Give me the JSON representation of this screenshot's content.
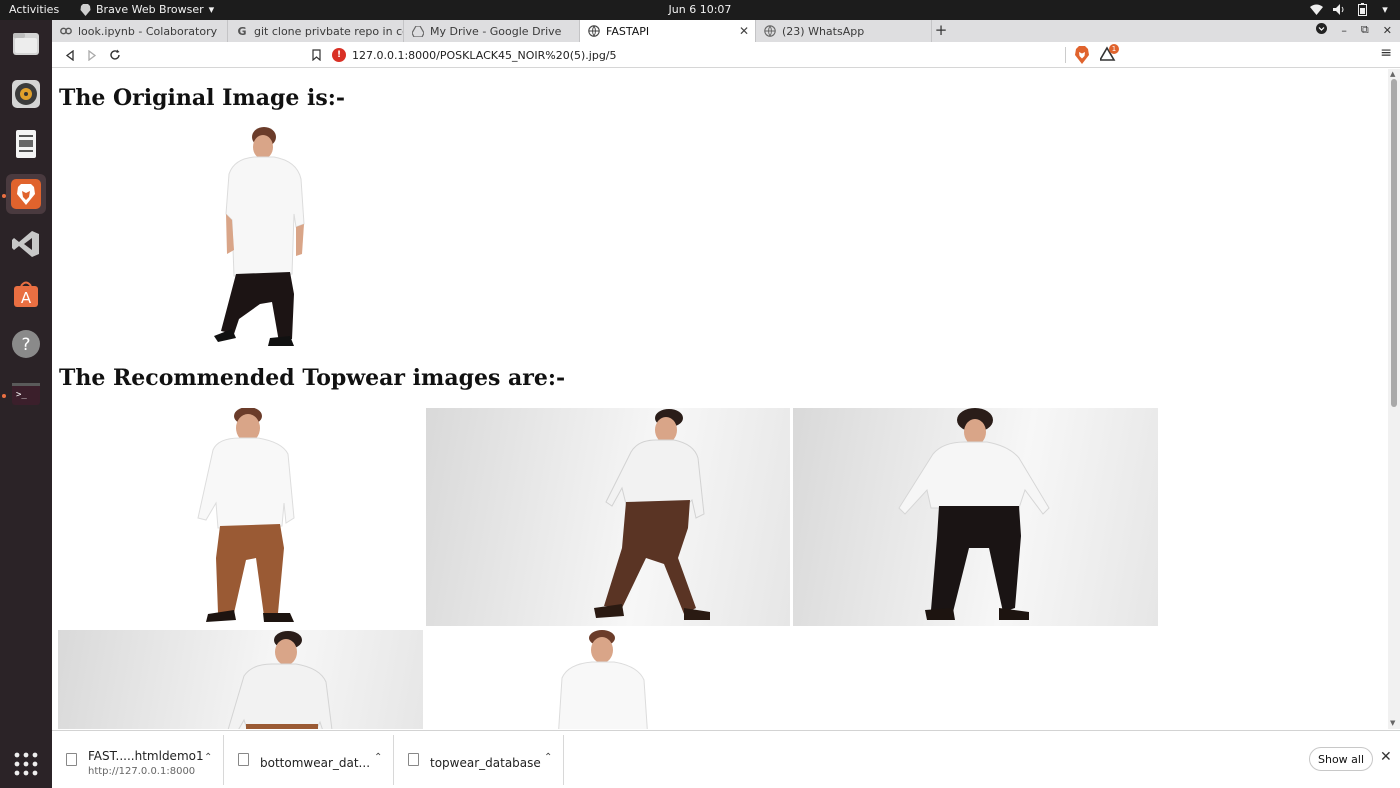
{
  "topbar": {
    "activities": "Activities",
    "app_menu": "Brave Web Browser",
    "clock": "Jun 6  10:07",
    "tray_icons": [
      "wifi-icon",
      "volume-icon",
      "battery-icon",
      "power-menu-icon"
    ]
  },
  "dock": {
    "items": [
      "files-icon",
      "rhythmbox-icon",
      "document-viewer-icon",
      "brave-browser-icon",
      "vscode-icon",
      "software-store-icon",
      "help-icon",
      "terminal-icon"
    ],
    "show_apps_icon": "app-grid-icon"
  },
  "tabs": [
    {
      "title": "look.ipynb - Colaboratory",
      "icon": "colab-icon",
      "active": false
    },
    {
      "title": "git clone privbate repo in cola",
      "icon": "google-g-icon",
      "active": false
    },
    {
      "title": "My Drive - Google Drive",
      "icon": "drive-icon",
      "active": false
    },
    {
      "title": "FASTAPI",
      "icon": "globe-icon",
      "active": true
    },
    {
      "title": "(23) WhatsApp",
      "icon": "globe-icon",
      "active": false
    }
  ],
  "new_tab": "+",
  "window_controls": [
    "menu-circle-icon",
    "minimize-icon",
    "restore-icon",
    "close-icon"
  ],
  "toolbar": {
    "url": "127.0.0.1:8000/POSKLACK45_NOIR%20(5).jpg/5",
    "rewards_badge": "1",
    "menu": "≡"
  },
  "page": {
    "heading_original": "The Original Image is:-",
    "heading_recommended": "The Recommended Topwear images are:-"
  },
  "downloads": [
    {
      "name": "FAST.....htmldemo1",
      "source": "http://127.0.0.1:8000"
    },
    {
      "name": "bottomwear_dat..."
    },
    {
      "name": "topwear_database"
    }
  ],
  "show_all": "Show all",
  "colors": {
    "topbar": "#1c1c1c",
    "dock": "#2b2327",
    "tabstrip": "#dedee0",
    "accent_orange": "#e96f42"
  }
}
